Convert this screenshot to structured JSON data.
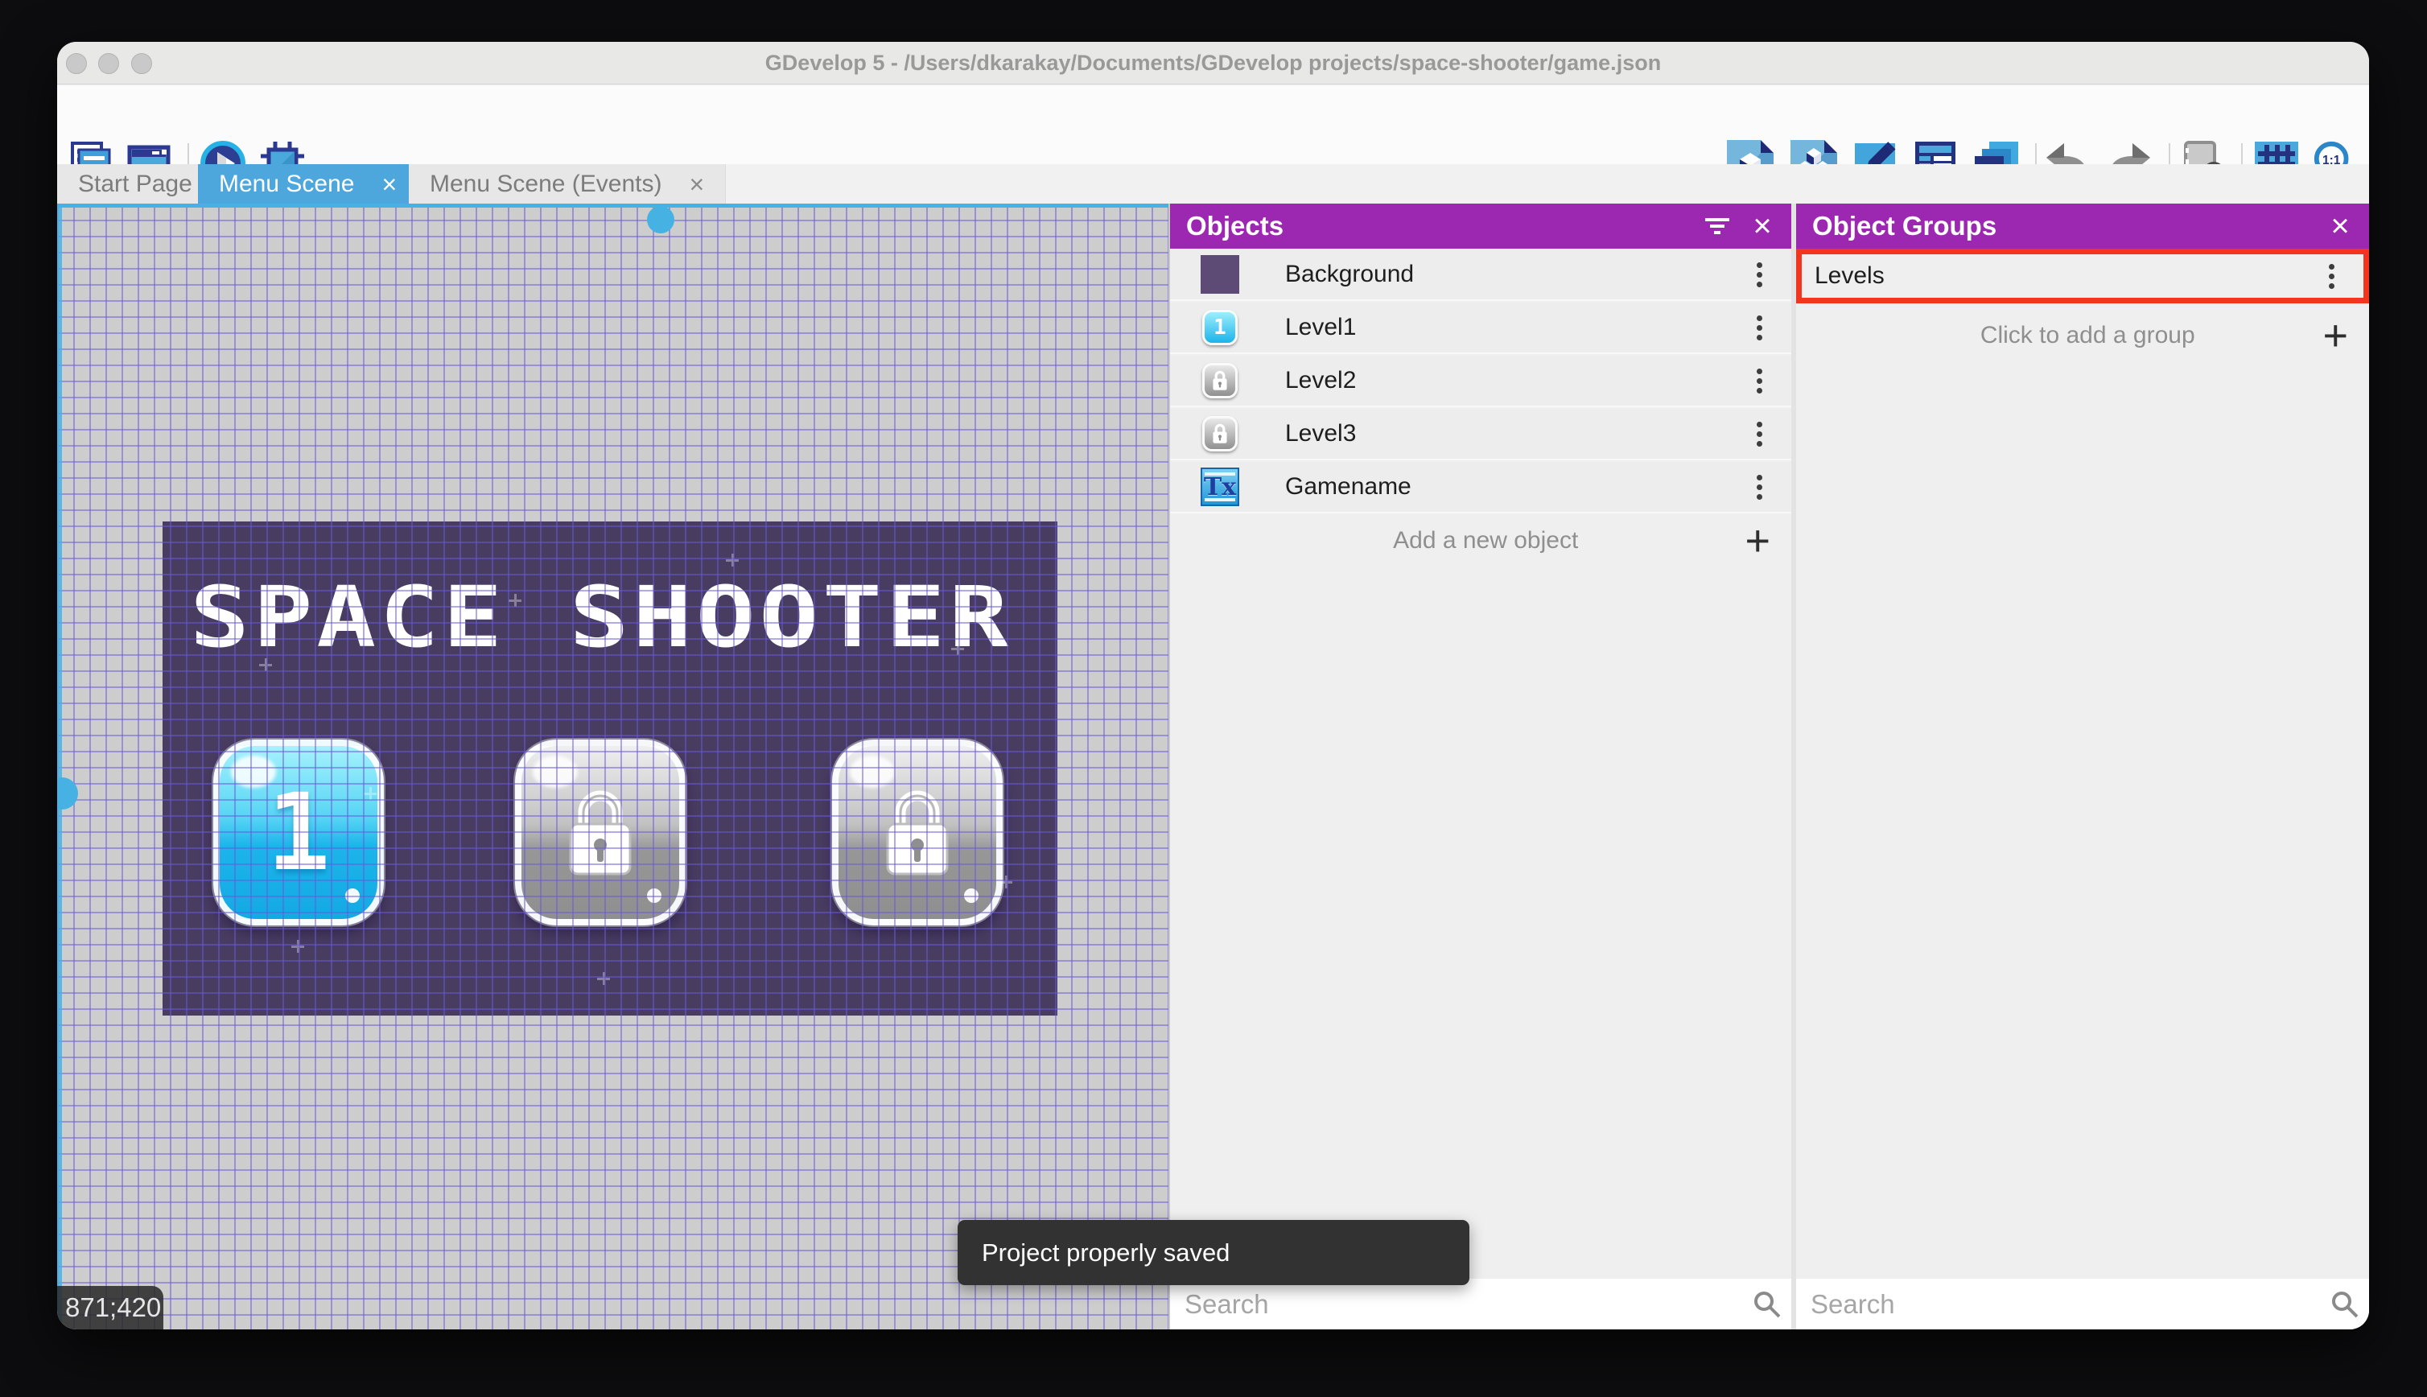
{
  "window": {
    "title": "GDevelop 5 - /Users/dkarakay/Documents/GDevelop projects/space-shooter/game.json"
  },
  "tabs": [
    {
      "label": "Start Page",
      "active": false,
      "closable": false
    },
    {
      "label": "Menu Scene",
      "active": true,
      "closable": true
    },
    {
      "label": "Menu Scene (Events)",
      "active": false,
      "closable": true
    }
  ],
  "toolbar": {
    "left_icons": [
      "project-manager",
      "new-window",
      "preview-play",
      "debugger"
    ],
    "right_icons": [
      "objects-panel",
      "object-groups-panel",
      "properties-panel",
      "instances-list-panel",
      "layers-panel",
      "undo",
      "redo",
      "window-mask",
      "grid",
      "zoom-1-1"
    ]
  },
  "icons": {
    "close_glyph": "×",
    "add_glyph": "+",
    "zoom_ratio": "1:1",
    "text_object_glyph": "Tx"
  },
  "canvas": {
    "coordinates": "871;420",
    "scene": {
      "title": "SPACE SHOOTER",
      "level_buttons": [
        {
          "label": "1",
          "locked": false
        },
        {
          "label": "",
          "locked": true
        },
        {
          "label": "",
          "locked": true
        }
      ]
    }
  },
  "objects_panel": {
    "title": "Objects",
    "items": [
      {
        "name": "Background",
        "thumb": "background"
      },
      {
        "name": "Level1",
        "thumb": "level1-button"
      },
      {
        "name": "Level2",
        "thumb": "locked-button"
      },
      {
        "name": "Level3",
        "thumb": "locked-button"
      },
      {
        "name": "Gamename",
        "thumb": "text-object"
      }
    ],
    "add_label": "Add a new object",
    "search_placeholder": "Search"
  },
  "object_groups_panel": {
    "title": "Object Groups",
    "groups": [
      {
        "name": "Levels",
        "highlighted": true
      }
    ],
    "add_label": "Click to add a group",
    "search_placeholder": "Search"
  },
  "toast": {
    "message": "Project properly saved"
  },
  "colors": {
    "panel_header": "#9C27B0",
    "active_tab": "#4DA6DC",
    "highlight_red": "#F2351F",
    "toast_bg": "#323232",
    "scene_bg": "#493C61",
    "grid_line": "#685ADA",
    "canvas_bg": "#CDCDCD"
  }
}
